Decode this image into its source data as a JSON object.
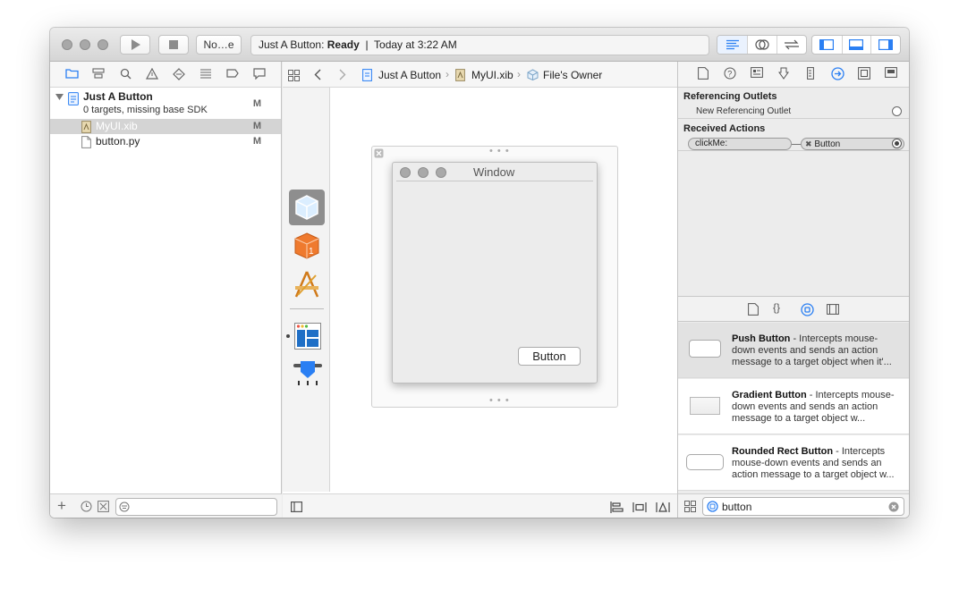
{
  "toolbar": {
    "scheme": "No…e",
    "status_project": "Just A Button",
    "status_separator": ":",
    "status_state": "Ready",
    "status_divider": "|",
    "status_time": "Today at 3:22 AM"
  },
  "navigator": {
    "project_name": "Just A Button",
    "project_sub": "0 targets, missing base SDK",
    "project_flag": "M",
    "files": [
      {
        "name": "MyUI.xib",
        "flag": "M"
      },
      {
        "name": "button.py",
        "flag": "M"
      }
    ],
    "add_label": "+"
  },
  "jumpbar": {
    "items": [
      "Just A Button",
      "MyUI.xib",
      "File's Owner"
    ]
  },
  "canvas": {
    "window_title": "Window",
    "button_label": "Button"
  },
  "inspector": {
    "referencing_outlets": "Referencing Outlets",
    "new_referencing_outlet": "New Referencing Outlet",
    "received_actions": "Received Actions",
    "action_name": "clickMe:",
    "action_target": "Button"
  },
  "library": {
    "items": [
      {
        "name": "Push Button",
        "desc": " - Intercepts mouse-down events and sends an action message to a target object when it'..."
      },
      {
        "name": "Gradient Button",
        "desc": " - Intercepts mouse-down events and sends an action message to a target object w..."
      },
      {
        "name": "Rounded Rect Button",
        "desc": " - Intercepts mouse-down events and sends an action message to a target object w..."
      }
    ],
    "search_value": "button"
  },
  "colors": {
    "accent": "#2a7ff3",
    "selection": "#d4d4d4"
  }
}
